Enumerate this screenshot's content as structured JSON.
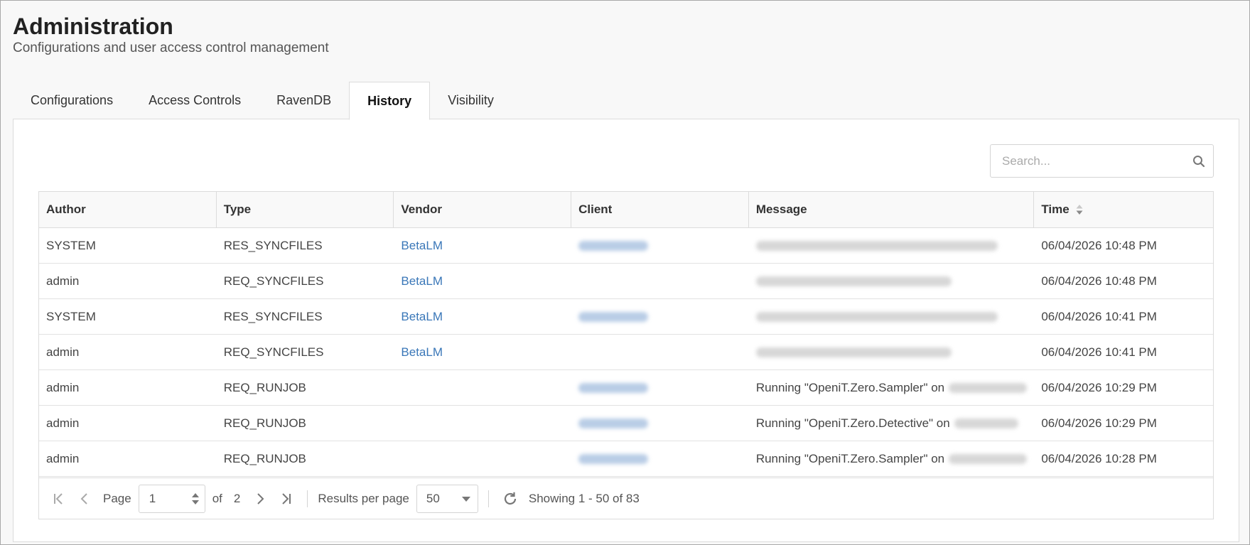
{
  "header": {
    "title": "Administration",
    "subtitle": "Configurations and user access control management"
  },
  "tabs": [
    {
      "label": "Configurations",
      "active": false
    },
    {
      "label": "Access Controls",
      "active": false
    },
    {
      "label": "RavenDB",
      "active": false
    },
    {
      "label": "History",
      "active": true
    },
    {
      "label": "Visibility",
      "active": false
    }
  ],
  "search": {
    "placeholder": "Search...",
    "value": "",
    "icon": "search-icon"
  },
  "table": {
    "columns": [
      "Author",
      "Type",
      "Vendor",
      "Client",
      "Message",
      "Time"
    ],
    "sort": {
      "column": "Time",
      "icon": "sort-icon"
    },
    "rows": [
      {
        "author": "SYSTEM",
        "type": "RES_SYNCFILES",
        "vendor": "BetaLM",
        "message": "",
        "time": "06/04/2026 10:48 PM"
      },
      {
        "author": "admin",
        "type": "REQ_SYNCFILES",
        "vendor": "BetaLM",
        "message": "",
        "time": "06/04/2026 10:48 PM"
      },
      {
        "author": "SYSTEM",
        "type": "RES_SYNCFILES",
        "vendor": "BetaLM",
        "message": "",
        "time": "06/04/2026 10:41 PM"
      },
      {
        "author": "admin",
        "type": "REQ_SYNCFILES",
        "vendor": "BetaLM",
        "message": "",
        "time": "06/04/2026 10:41 PM"
      },
      {
        "author": "admin",
        "type": "REQ_RUNJOB",
        "vendor": "",
        "message": "Running \"OpeniT.Zero.Sampler\" on",
        "time": "06/04/2026 10:29 PM"
      },
      {
        "author": "admin",
        "type": "REQ_RUNJOB",
        "vendor": "",
        "message": "Running \"OpeniT.Zero.Detective\" on",
        "time": "06/04/2026 10:29 PM"
      },
      {
        "author": "admin",
        "type": "REQ_RUNJOB",
        "vendor": "",
        "message": "Running \"OpeniT.Zero.Sampler\" on",
        "time": "06/04/2026 10:28 PM"
      }
    ]
  },
  "pager": {
    "page_label": "Page",
    "page_value": "1",
    "of_label": "of",
    "total_pages": "2",
    "results_label": "Results per page",
    "per_page": "50",
    "showing": "Showing 1 - 50 of 83"
  },
  "colors": {
    "link": "#3a77b8",
    "border": "#dcdcdc",
    "background": "#f8f8f8"
  }
}
